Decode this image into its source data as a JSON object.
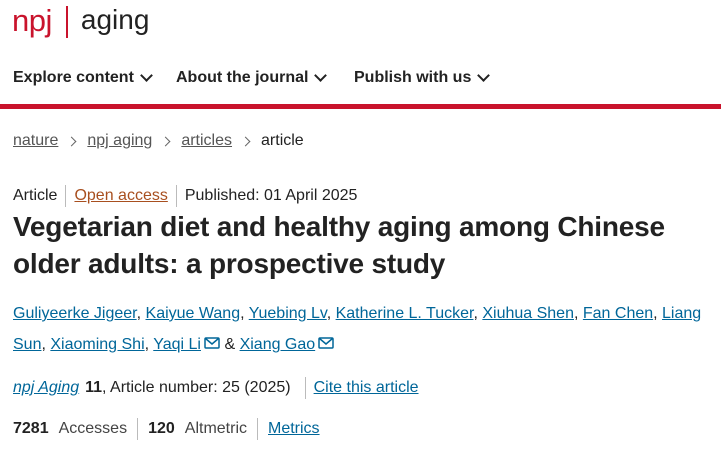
{
  "logo": {
    "brand": "npj",
    "journal": "aging"
  },
  "nav": {
    "items": [
      {
        "label": "Explore content"
      },
      {
        "label": "About the journal"
      },
      {
        "label": "Publish with us"
      }
    ]
  },
  "breadcrumb": {
    "items": [
      "nature",
      "npj aging",
      "articles"
    ],
    "current": "article"
  },
  "article": {
    "type": "Article",
    "access": "Open access",
    "published": "Published: 01 April 2025",
    "title_line1": "Vegetarian diet and healthy aging among Chinese",
    "title_line2": "older adults: a prospective study",
    "authors": [
      "Guliyeerke Jigeer",
      "Kaiyue Wang",
      "Yuebing Lv",
      "Katherine L. Tucker",
      "Xiuhua Shen",
      "Fan Chen",
      "Liang Sun",
      "Xiaoming Shi",
      "Yaqi Li",
      "Xiang Gao"
    ],
    "author_conjunction": "&",
    "mail_icon": "envelope-icon"
  },
  "citation": {
    "journal": "npj Aging",
    "volume": "11",
    "article_number": ", Article number: 25 (2025)",
    "cite_label": "Cite this article"
  },
  "metrics": {
    "accesses_count": "7281",
    "accesses_label": "Accesses",
    "altmetric_count": "120",
    "altmetric_label": "Altmetric",
    "metrics_link": "Metrics"
  },
  "colors": {
    "brand_red": "#c9132c",
    "link_blue": "#006699",
    "open_access": "#a84f1f"
  }
}
